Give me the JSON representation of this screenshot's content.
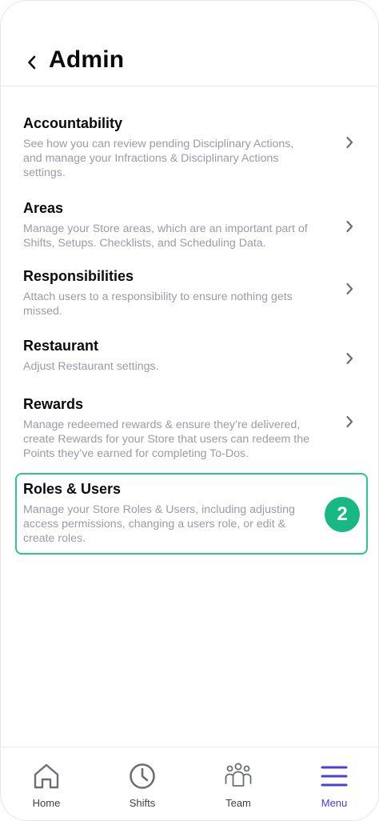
{
  "header": {
    "title": "Admin"
  },
  "items": [
    {
      "title": "Accountability",
      "description": "See how you can review pending Disciplinary Actions, and manage your Infractions & Disciplinary Actions settings."
    },
    {
      "title": "Areas",
      "description": "Manage your Store areas, which are an important part of Shifts, Setups. Checklists, and Scheduling Data."
    },
    {
      "title": "Responsibilities",
      "description": "Attach users to a responsibility to ensure nothing gets missed."
    },
    {
      "title": "Restaurant",
      "description": "Adjust Restaurant settings."
    },
    {
      "title": "Rewards",
      "description": "Manage redeemed rewards & ensure they’re delivered, create Rewards for your Store that users can redeem the Points they’ve earned for completing To-Dos."
    },
    {
      "title": "Roles & Users",
      "description": "Manage your Store Roles & Users, including adjusting access permissions, changing a users role, or edit & create roles."
    }
  ],
  "badge": {
    "value": "2",
    "color": "#17b883"
  },
  "highlight_color": "#2cc49a",
  "tabs": [
    {
      "label": "Home",
      "icon": "home-icon"
    },
    {
      "label": "Shifts",
      "icon": "clock-icon"
    },
    {
      "label": "Team",
      "icon": "team-icon"
    },
    {
      "label": "Menu",
      "icon": "hamburger-menu-icon",
      "active": true
    }
  ],
  "colors": {
    "accent": "#4a3fd6",
    "text_muted": "#9a9ca6"
  }
}
